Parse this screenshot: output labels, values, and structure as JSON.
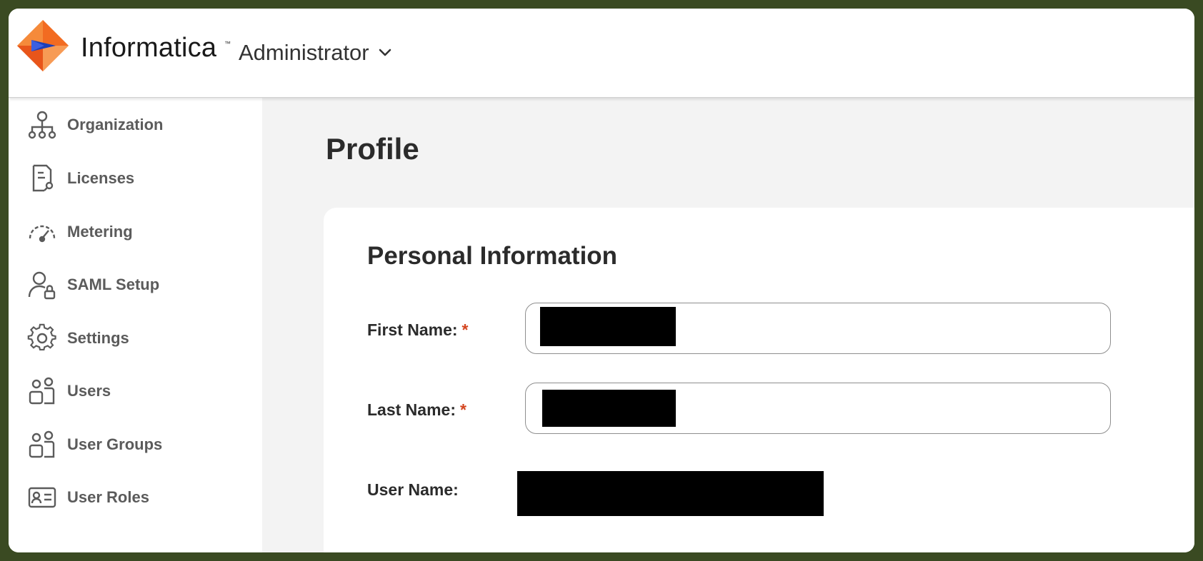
{
  "header": {
    "brand": "Informatica",
    "trademark": "™",
    "app_switcher": {
      "label": "Administrator"
    }
  },
  "sidebar": {
    "items": [
      {
        "label": "Organization",
        "icon": "organization-icon"
      },
      {
        "label": "Licenses",
        "icon": "license-icon"
      },
      {
        "label": "Metering",
        "icon": "gauge-icon"
      },
      {
        "label": "SAML Setup",
        "icon": "user-lock-icon"
      },
      {
        "label": "Settings",
        "icon": "gear-icon"
      },
      {
        "label": "Users",
        "icon": "users-icon"
      },
      {
        "label": "User Groups",
        "icon": "user-groups-icon"
      },
      {
        "label": "User Roles",
        "icon": "id-card-icon"
      }
    ]
  },
  "main": {
    "page_title": "Profile",
    "section_title": "Personal Information",
    "fields": {
      "first_name": {
        "label": "First Name:",
        "required_mark": "*",
        "value": "[redacted]"
      },
      "last_name": {
        "label": "Last Name:",
        "required_mark": "*",
        "value": "[redacted]"
      },
      "user_name": {
        "label": "User Name:",
        "value": "[redacted]"
      }
    }
  },
  "colors": {
    "brand_orange": "#f26b21",
    "required_red": "#d4451f",
    "nav_text": "#5b5b5b",
    "page_bg": "#f3f3f3"
  }
}
